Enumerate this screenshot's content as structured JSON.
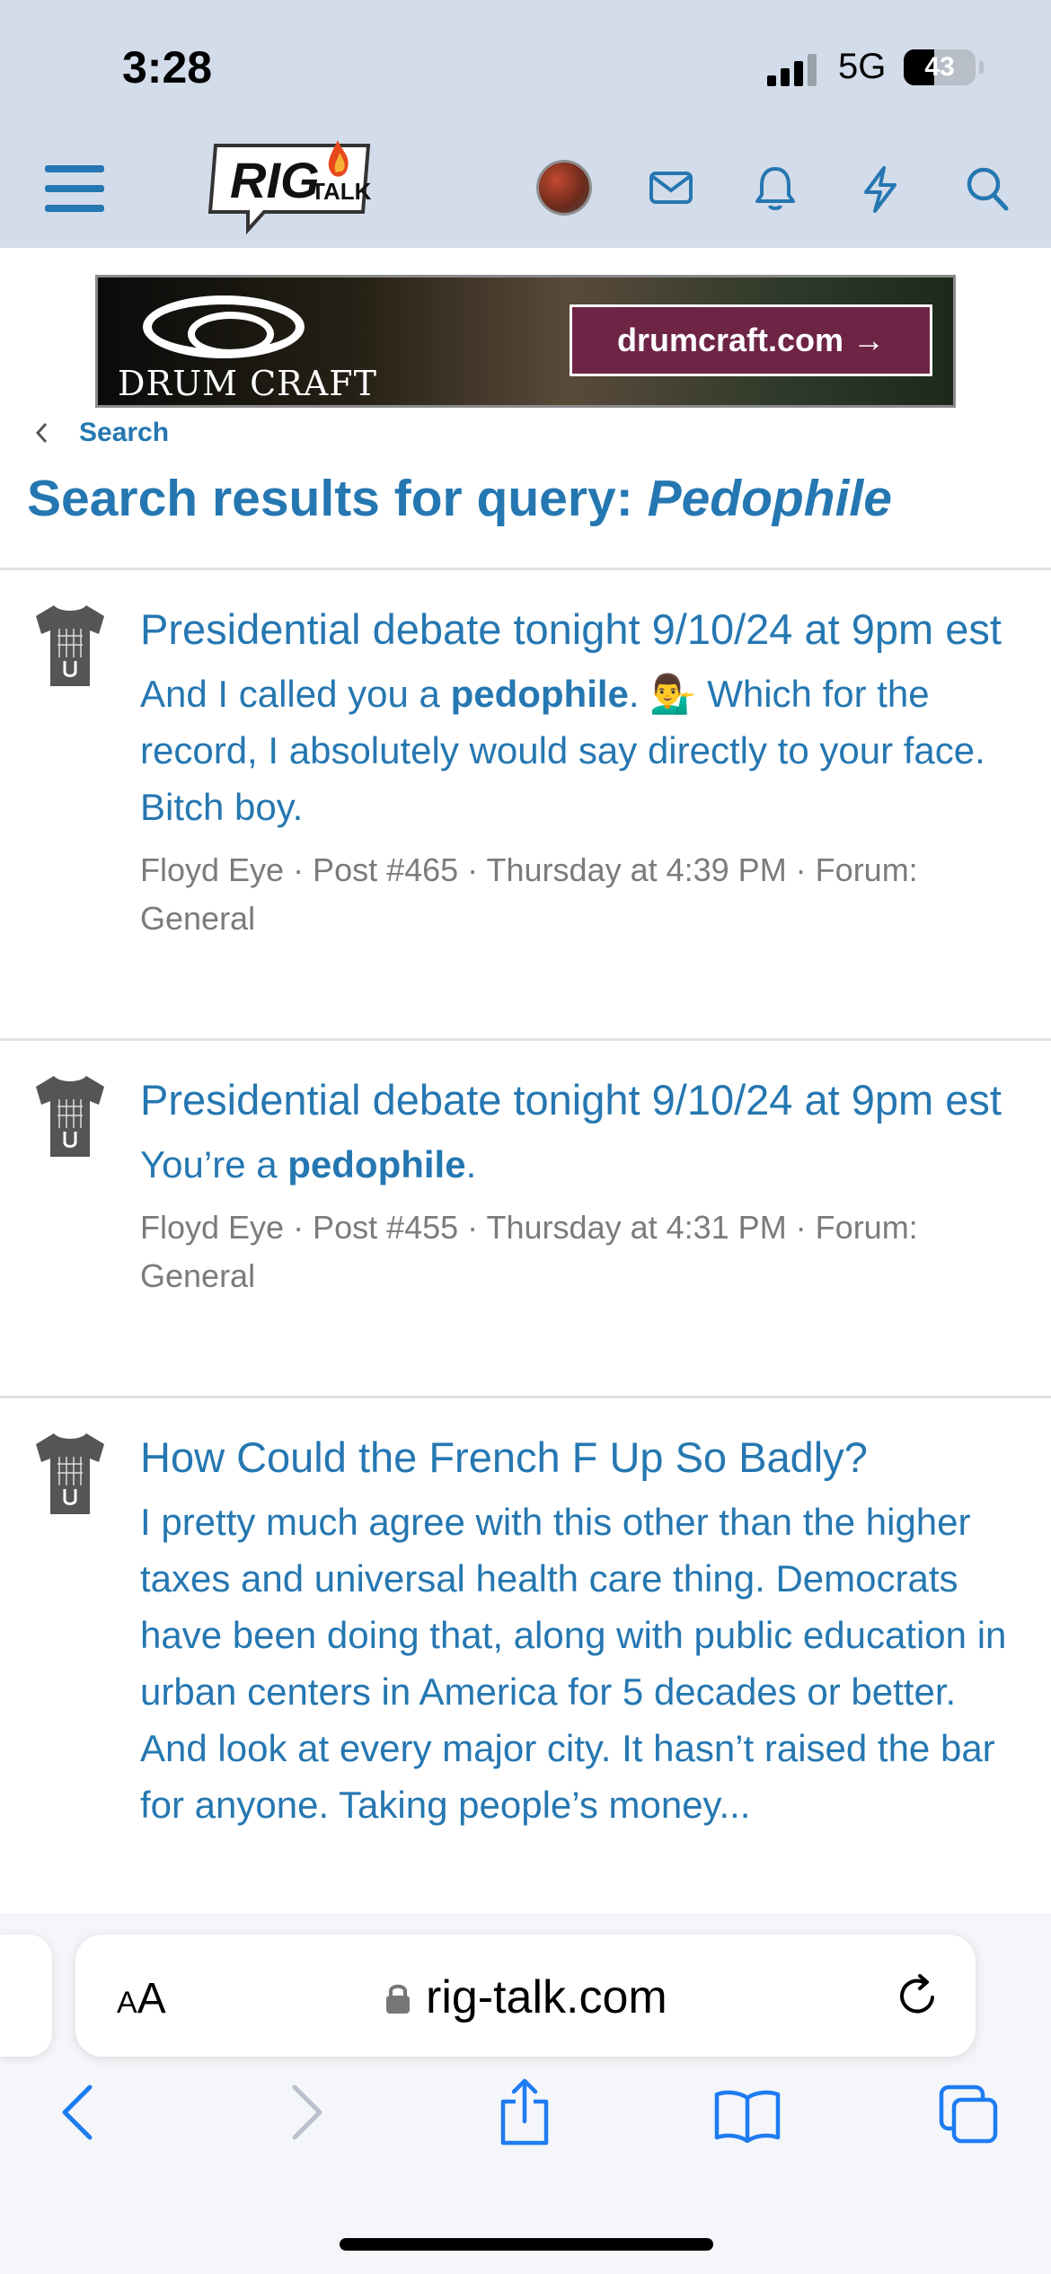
{
  "status_bar": {
    "time": "3:28",
    "network": "5G",
    "battery": "43",
    "battery_level": 0.43
  },
  "header": {
    "logo_text": "RIG",
    "logo_sub": "TALK",
    "icons": [
      "menu-icon",
      "avatar",
      "mail-icon",
      "bell-icon",
      "lightning-icon",
      "search-icon"
    ]
  },
  "ad": {
    "brand": "DRUM CRAFT",
    "cta": "drumcraft.com →"
  },
  "breadcrumb": {
    "label": "Search"
  },
  "page": {
    "title_prefix": "Search results for query: ",
    "query": "Pedophile"
  },
  "results": [
    {
      "title": "Presidential debate tonight 9/10/24 at 9pm est",
      "snippet_before": "And I called you a ",
      "snippet_bold": "pedophile",
      "snippet_after": ". 💁‍♂️ Which for the record, I absolutely would say directly to your face. Bitch boy.",
      "meta": "Floyd Eye · Post #465 · Thursday at 4:39 PM · Forum: General"
    },
    {
      "title": "Presidential debate tonight 9/10/24 at 9pm est",
      "snippet_before": "You’re a ",
      "snippet_bold": "pedophile",
      "snippet_after": ".",
      "meta": "Floyd Eye · Post #455 · Thursday at 4:31 PM · Forum: General"
    },
    {
      "title": "How Could the French F Up So Badly?",
      "snippet_before": "I pretty much agree with this other than the higher taxes and universal health care thing. Democrats have been doing that, along with public education in urban centers in America for 5 decades or better. And look at every major city. It hasn’t raised the bar for anyone. Taking people’s money...",
      "snippet_bold": "",
      "snippet_after": "",
      "meta": ""
    }
  ],
  "browser": {
    "text_size_label": "AA",
    "url": "rig-talk.com"
  },
  "colors": {
    "accent": "#2577b1",
    "header_bg": "#d3dcea",
    "meta": "#7b7b7b"
  }
}
